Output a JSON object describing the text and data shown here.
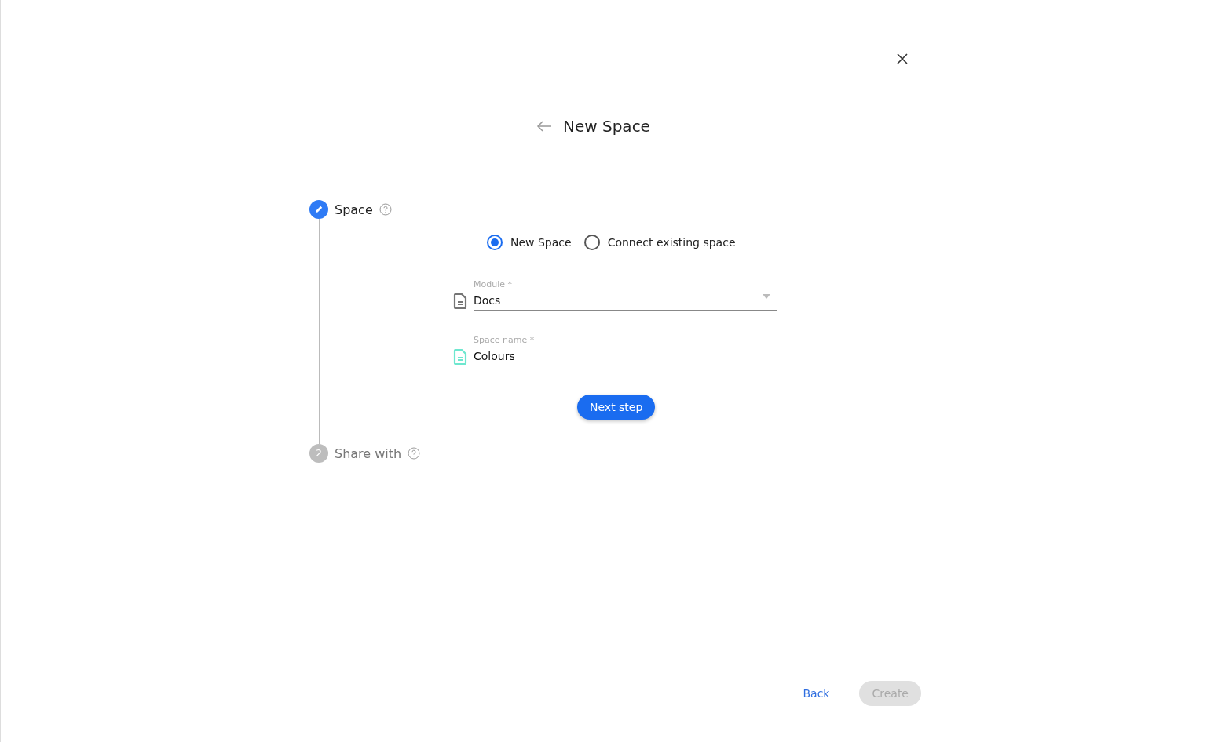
{
  "title": "New Space",
  "steps": [
    {
      "label": "Space",
      "active": true
    },
    {
      "label": "Share with",
      "active": false,
      "number": "2"
    }
  ],
  "space_type": [
    {
      "label": "New Space",
      "selected": true
    },
    {
      "label": "Connect existing space",
      "selected": false
    }
  ],
  "fields": [
    {
      "kind": "dropdown",
      "label": "Module *",
      "value": "Docs",
      "color": "#757575"
    },
    {
      "kind": "text",
      "label": "Space name *",
      "value": "Colours",
      "color": "#6ee7cf"
    }
  ],
  "next_button": "Next step",
  "footer": {
    "back": "Back",
    "create": {
      "label": "Create",
      "disabled": true
    }
  }
}
